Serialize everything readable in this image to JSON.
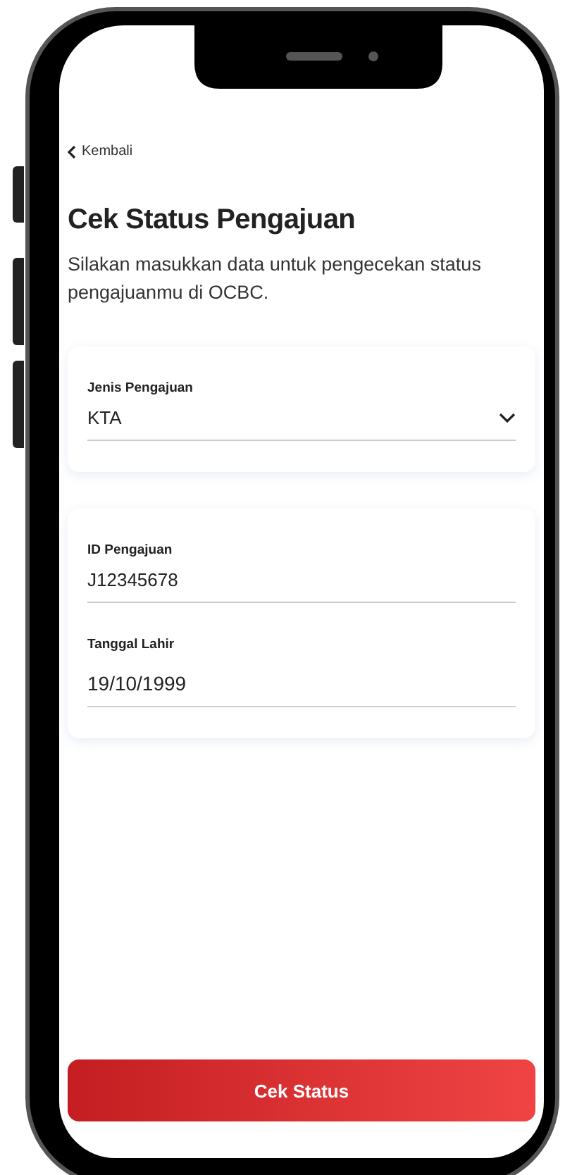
{
  "back_link": {
    "label": "Kembali"
  },
  "title": "Cek Status Pengajuan",
  "description": "Silakan masukkan data untuk pengecekan status pengajuanmu di OCBC.",
  "cards": [
    {
      "fields": [
        {
          "kind": "select",
          "label": "Jenis Pengajuan",
          "value": "KTA"
        }
      ]
    },
    {
      "fields": [
        {
          "kind": "text",
          "label": "ID Pengajuan",
          "value": "J12345678"
        },
        {
          "kind": "date",
          "label": "Tanggal Lahir",
          "value": "19/10/1999"
        }
      ]
    }
  ],
  "submit_button": {
    "label": "Cek Status"
  }
}
